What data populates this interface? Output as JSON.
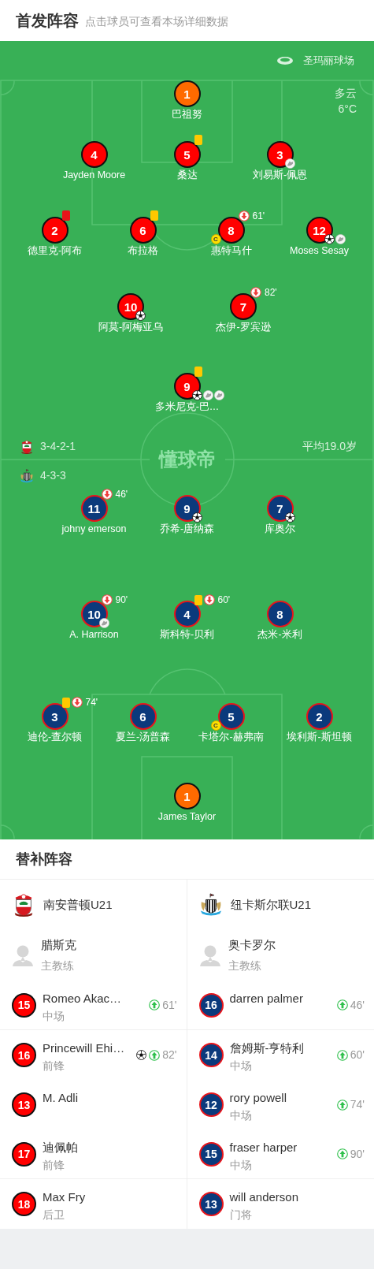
{
  "header": {
    "title": "首发阵容",
    "subtitle": "点击球员可查看本场详细数据"
  },
  "pitch": {
    "stadium": "圣玛丽球场",
    "weather": "多云",
    "temperature": "6°C",
    "watermark": "懂球帝",
    "teams": [
      {
        "kind": "home",
        "color": "#ff0000",
        "formation": "3-4-2-1",
        "average_age": "平均19.0岁",
        "lines": [
          [
            {
              "number": "1",
              "name": "巴祖努",
              "kind": "goalkeeper"
            }
          ],
          [
            {
              "number": "4",
              "name": "Jayden Moore",
              "kind": "outfield"
            },
            {
              "number": "5",
              "name": "桑达",
              "kind": "outfield",
              "yellow_card": true
            },
            {
              "number": "3",
              "name": "刘易斯-佩恩",
              "kind": "outfield",
              "events": [
                {
                  "kind": "assist"
                }
              ]
            }
          ],
          [
            {
              "number": "2",
              "name": "德里克-阿布",
              "kind": "outfield",
              "red_card": true
            },
            {
              "number": "6",
              "name": "布拉格",
              "kind": "outfield",
              "yellow_card": true
            },
            {
              "number": "8",
              "name": "惠特马什",
              "kind": "outfield",
              "sub_out": "61'",
              "captain_badge": "C"
            },
            {
              "number": "12",
              "name": "Moses Sesay",
              "kind": "outfield",
              "events": [
                {
                  "kind": "goal"
                },
                {
                  "kind": "assist"
                }
              ]
            }
          ],
          [
            {
              "number": "10",
              "name": "阿莫-阿梅亚乌",
              "kind": "outfield",
              "events": [
                {
                  "kind": "goal"
                }
              ]
            },
            {
              "number": "7",
              "name": "杰伊-罗宾逊",
              "kind": "outfield",
              "sub_out": "82'"
            }
          ],
          [
            {
              "number": "9",
              "name": "多米尼克-巴…",
              "kind": "outfield",
              "yellow_card": true,
              "events": [
                {
                  "kind": "goal"
                },
                {
                  "kind": "assist"
                },
                {
                  "kind": "assist"
                }
              ]
            }
          ]
        ]
      },
      {
        "kind": "away",
        "color": "#0b3a7c",
        "formation": "4-3-3",
        "lines": [
          [
            {
              "number": "11",
              "name": "johny emerson",
              "kind": "outfield",
              "sub_out": "46'"
            },
            {
              "number": "9",
              "name": "乔希-唐纳森",
              "kind": "outfield",
              "events": [
                {
                  "kind": "goal"
                }
              ]
            },
            {
              "number": "7",
              "name": "库奥尔",
              "kind": "outfield",
              "events": [
                {
                  "kind": "goal"
                }
              ]
            }
          ],
          [
            {
              "number": "10",
              "name": "A. Harrison",
              "kind": "outfield",
              "sub_out": "90'",
              "events": [
                {
                  "kind": "assist"
                }
              ]
            },
            {
              "number": "4",
              "name": "斯科特-贝利",
              "kind": "outfield",
              "yellow_card": true,
              "sub_out": "60'"
            },
            {
              "number": "8",
              "name": "杰米-米利",
              "kind": "outfield"
            }
          ],
          [
            {
              "number": "3",
              "name": "迪伦-查尔顿",
              "kind": "outfield",
              "yellow_card": true,
              "sub_out": "74'"
            },
            {
              "number": "6",
              "name": "夏兰-汤普森",
              "kind": "outfield"
            },
            {
              "number": "5",
              "name": "卡塔尔-赫弗南",
              "kind": "outfield",
              "captain_badge": "C"
            },
            {
              "number": "2",
              "name": "埃利斯-斯坦顿",
              "kind": "outfield"
            }
          ],
          [
            {
              "number": "1",
              "name": "James Taylor",
              "kind": "goalkeeper"
            }
          ]
        ]
      }
    ]
  },
  "substitutes": {
    "title": "替补阵容",
    "teams": [
      {
        "kind": "home",
        "color": "#ff0000",
        "name": "南安普顿U21",
        "coach": {
          "name": "腊斯克",
          "role": "主教练"
        },
        "players": [
          {
            "number": "15",
            "name": "Romeo Akac…",
            "position": "中场",
            "sub_in": "61'"
          },
          {
            "number": "16",
            "name": "Princewill Ehi…",
            "position": "前锋",
            "sub_in": "82'",
            "events": [
              {
                "kind": "goal"
              }
            ]
          },
          {
            "number": "13",
            "name": "M. Adli"
          },
          {
            "number": "17",
            "name": "迪佩帕",
            "position": "前锋"
          },
          {
            "number": "18",
            "name": "Max Fry",
            "position": "后卫"
          }
        ]
      },
      {
        "kind": "away",
        "color": "#0b3a7c",
        "name": "纽卡斯尔联U21",
        "coach": {
          "name": "奥卡罗尔",
          "role": "主教练"
        },
        "players": [
          {
            "number": "16",
            "name": "darren palmer",
            "sub_in": "46'"
          },
          {
            "number": "14",
            "name": "詹姆斯-亨特利",
            "position": "中场",
            "sub_in": "60'"
          },
          {
            "number": "12",
            "name": "rory powell",
            "position": "中场",
            "sub_in": "74'"
          },
          {
            "number": "15",
            "name": "fraser harper",
            "position": "中场",
            "sub_in": "90'"
          },
          {
            "number": "13",
            "name": "will anderson",
            "position": "门将"
          }
        ]
      }
    ]
  }
}
